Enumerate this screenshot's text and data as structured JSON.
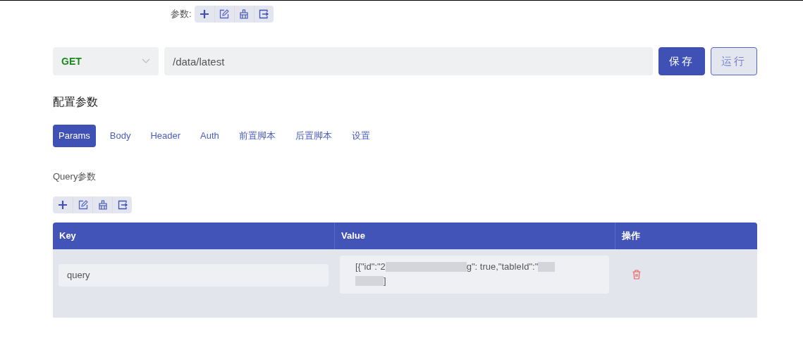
{
  "top_toolbar": {
    "label": "参数:",
    "tools": [
      {
        "kind": "plus"
      },
      {
        "kind": "edit"
      },
      {
        "kind": "clear"
      },
      {
        "kind": "export"
      }
    ]
  },
  "request": {
    "method": "GET",
    "url": "/data/latest",
    "buttons": [
      {
        "label": "保存",
        "kind": "primary"
      },
      {
        "label": "运行",
        "kind": "secondary"
      }
    ]
  },
  "section_title": "配置参数",
  "tabs": [
    {
      "label": "Params",
      "selected": true
    },
    {
      "label": "Body",
      "selected": false
    },
    {
      "label": "Header",
      "selected": false
    },
    {
      "label": "Auth",
      "selected": false
    },
    {
      "label": "前置脚本",
      "selected": false
    },
    {
      "label": "后置脚本",
      "selected": false
    },
    {
      "label": "设置",
      "selected": false
    }
  ],
  "query_title": "Query参数",
  "query_toolbar": {
    "tools": [
      {
        "kind": "plus"
      },
      {
        "kind": "edit"
      },
      {
        "kind": "clear"
      },
      {
        "kind": "export"
      }
    ]
  },
  "table": {
    "columns": [
      "Key",
      "Value",
      "操作"
    ],
    "rows": [
      {
        "key": "query",
        "value_segments": [
          "[{\"id\":\"2",
          "g\": true,\"tableId\":\"",
          "]"
        ]
      }
    ]
  }
}
